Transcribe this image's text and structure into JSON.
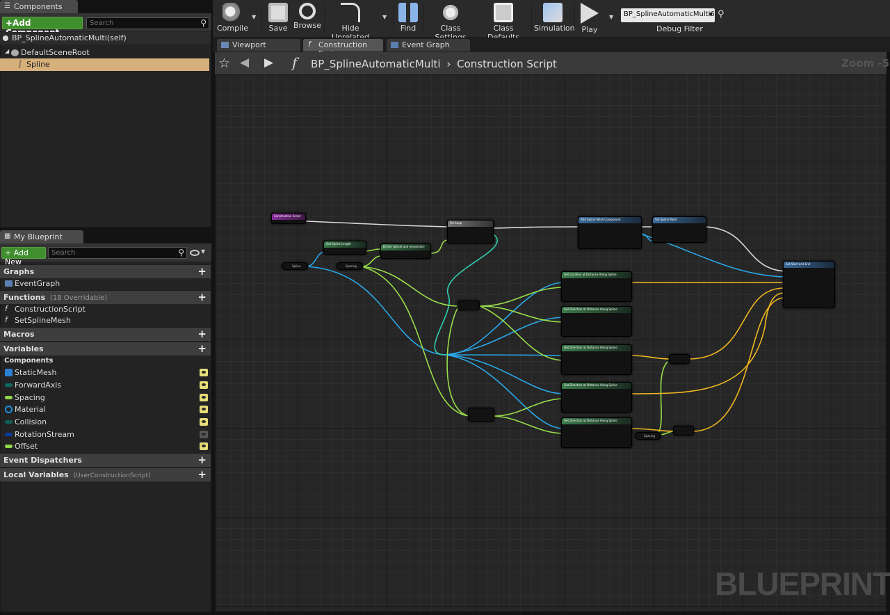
{
  "components_panel": {
    "tab": "Components",
    "add_button": "+Add Component",
    "search_placeholder": "Search",
    "self_item": "BP_SplineAutomaticMulti(self)",
    "tree": [
      "DefaultSceneRoot",
      "Spline"
    ]
  },
  "blueprint_panel": {
    "tab": "My Blueprint",
    "add_button": "+ Add New",
    "search_placeholder": "Search",
    "graphs": {
      "header": "Graphs",
      "items": [
        "EventGraph"
      ]
    },
    "functions": {
      "header": "Functions",
      "count": "(18 Overridable)",
      "items": [
        "ConstructionScript",
        "SetSplineMesh"
      ]
    },
    "macros": {
      "header": "Macros"
    },
    "variables": {
      "header": "Variables",
      "category": "Components",
      "items": [
        {
          "name": "StaticMesh",
          "color": "#2a7fd0"
        },
        {
          "name": "ForwardAxis",
          "color": "#0e6b62"
        },
        {
          "name": "Spacing",
          "color": "#8fd94a"
        },
        {
          "name": "Material",
          "color": "#1e8fe0"
        },
        {
          "name": "Collision",
          "color": "#0e5f58"
        },
        {
          "name": "RotationStream",
          "color": "#0d3aa0"
        },
        {
          "name": "Offset",
          "color": "#8fd94a"
        }
      ]
    },
    "dispatchers": {
      "header": "Event Dispatchers"
    },
    "locals": {
      "header": "Local Variables",
      "sub": "(UserConstructionScript)"
    }
  },
  "toolbar": {
    "buttons": [
      "Compile",
      "Save",
      "Browse",
      "Hide Unrelated",
      "Find",
      "Class Settings",
      "Class Defaults",
      "Simulation",
      "Play"
    ],
    "debug_select": "BP_SplineAutomaticMulti6",
    "debug_label": "Debug Filter"
  },
  "doc_tabs": [
    "Viewport",
    "Construction Scrip",
    "Event Graph"
  ],
  "breadcrumb": {
    "blueprint": "BP_SplineAutomaticMulti",
    "graph": "Construction Script"
  },
  "zoom": "Zoom -5",
  "watermark": "BLUEPRINT",
  "nodes": {
    "construction": "Construction Script",
    "spline_length": "Get Spline Length",
    "divide": "Divide (whole and remainder)",
    "for_loop": "For Loop",
    "add_mesh": "Add Spline Mesh Component",
    "set_mesh": "Set Spline Mesh",
    "set_start_end": "Set Start and End",
    "loc1": "Get Location at Distance Along Spline",
    "loc2": "Get Direction at Distance Along Spline",
    "loc3": "Get Direction at Distance Along Spline",
    "loc4": "Get Direction at Distance Along Spline",
    "loc5": "Get Direction at Distance Along Spline",
    "var_spline": "Spline",
    "var_spacing": "Spacing",
    "var_spacing2": "Spacing"
  }
}
